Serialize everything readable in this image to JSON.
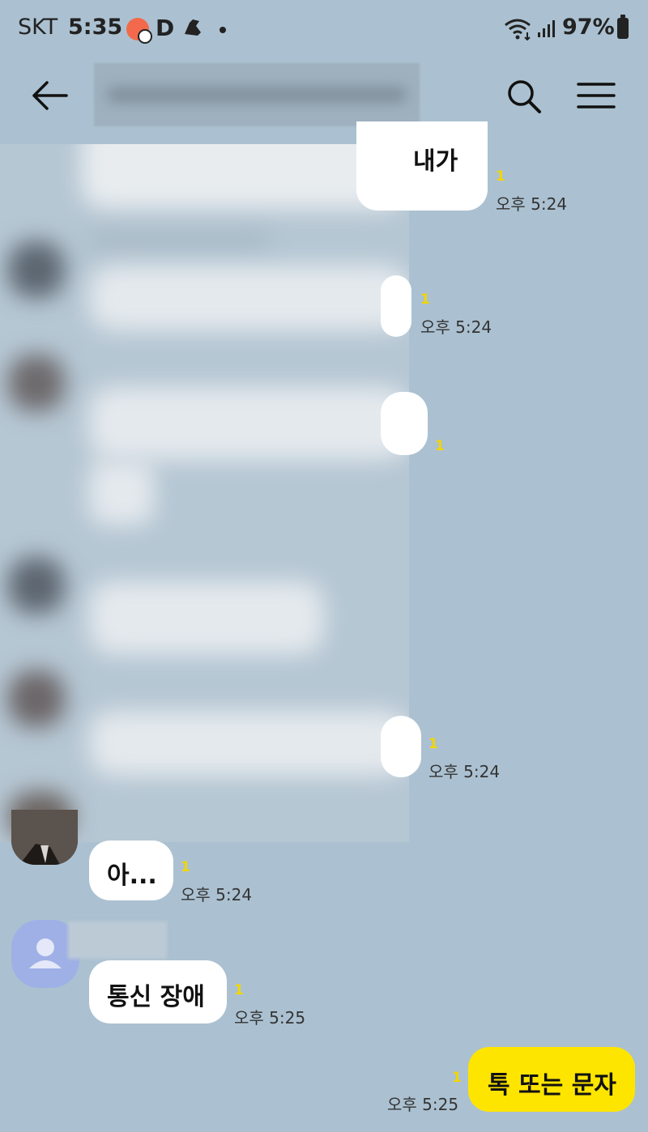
{
  "status_bar": {
    "carrier": "SKT",
    "time": "5:35",
    "app_letter": "D",
    "battery": "97%"
  },
  "header": {
    "title": "",
    "back_icon": "arrow-left-icon",
    "search_icon": "search-icon",
    "menu_icon": "hamburger-menu-icon"
  },
  "messages": [
    {
      "text": "내가",
      "unread": "1",
      "time": "오후 5:24"
    },
    {
      "text": "",
      "unread": "1",
      "time": "오후 5:24"
    },
    {
      "text": "",
      "unread": "1",
      "time": ""
    },
    {
      "text": "",
      "unread": "1",
      "time": "오후 5:24"
    },
    {
      "text": "아...",
      "unread": "1",
      "time": "오후 5:24"
    },
    {
      "text": "통신 장애",
      "unread": "1",
      "time": "오후 5:25"
    },
    {
      "text": "톡 또는 문자",
      "unread": "1",
      "time": "오후 5:25",
      "mine": true
    }
  ],
  "colors": {
    "background": "#abc1d1",
    "my_bubble": "#fee500",
    "other_bubble": "#ffffff",
    "unread_count": "#f2d500"
  }
}
